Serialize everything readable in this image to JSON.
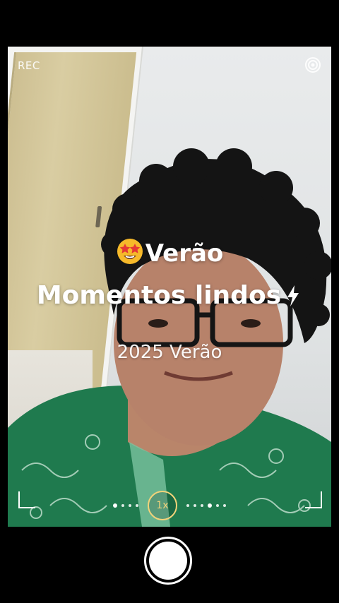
{
  "camera": {
    "rec_label": "REC",
    "settings_icon": "target-icon",
    "zoom_label": "1x",
    "accent_color": "#f2d37a"
  },
  "overlay": {
    "emoji_name": "star-struck-emoji",
    "title": "Verão",
    "subtitle": "Momentos lindos",
    "subtitle_icon": "lightning-icon",
    "year_line": "2025 Verão"
  }
}
